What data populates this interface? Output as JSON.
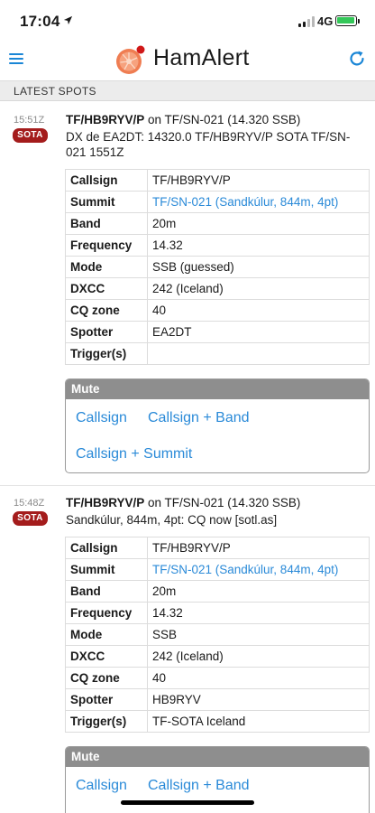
{
  "status": {
    "time": "17:04",
    "network": "4G"
  },
  "app": {
    "title": "HamAlert"
  },
  "section": {
    "title": "LATEST SPOTS"
  },
  "labels": {
    "callsign": "Callsign",
    "summit": "Summit",
    "band": "Band",
    "frequency": "Frequency",
    "mode": "Mode",
    "dxcc": "DXCC",
    "cq_zone": "CQ zone",
    "spotter": "Spotter",
    "triggers": "Trigger(s)",
    "mute": "Mute",
    "mute_callsign": "Callsign",
    "mute_callsign_band": "Callsign + Band",
    "mute_callsign_summit": "Callsign + Summit"
  },
  "spots": [
    {
      "time": "15:51Z",
      "badge": "SOTA",
      "callsign": "TF/HB9RYV/P",
      "on_text": " on TF/SN-021 (14.320 SSB)",
      "text": "DX de EA2DT: 14320.0 TF/HB9RYV/P SOTA TF/SN-021 1551Z",
      "details": {
        "callsign": "TF/HB9RYV/P",
        "summit": "TF/SN-021 (Sandkúlur, 844m, 4pt)",
        "band": "20m",
        "frequency": "14.32",
        "mode": "SSB (guessed)",
        "dxcc": "242 (Iceland)",
        "cq_zone": "40",
        "spotter": "EA2DT",
        "triggers": ""
      }
    },
    {
      "time": "15:48Z",
      "badge": "SOTA",
      "callsign": "TF/HB9RYV/P",
      "on_text": " on TF/SN-021 (14.320 SSB)",
      "text": "Sandkúlur, 844m, 4pt: CQ now [sotl.as]",
      "details": {
        "callsign": "TF/HB9RYV/P",
        "summit": "TF/SN-021 (Sandkúlur, 844m, 4pt)",
        "band": "20m",
        "frequency": "14.32",
        "mode": "SSB",
        "dxcc": "242 (Iceland)",
        "cq_zone": "40",
        "spotter": "HB9RYV",
        "triggers": "TF-SOTA Iceland"
      }
    }
  ],
  "colors": {
    "accent": "#2a8ad8",
    "badge": "#a41c1c",
    "mute_header": "#8e8e8e"
  },
  "icons": {
    "menu": "hamburger-icon",
    "logo": "hamalert-logo-icon",
    "refresh": "refresh-icon",
    "location": "location-arrow-icon"
  }
}
